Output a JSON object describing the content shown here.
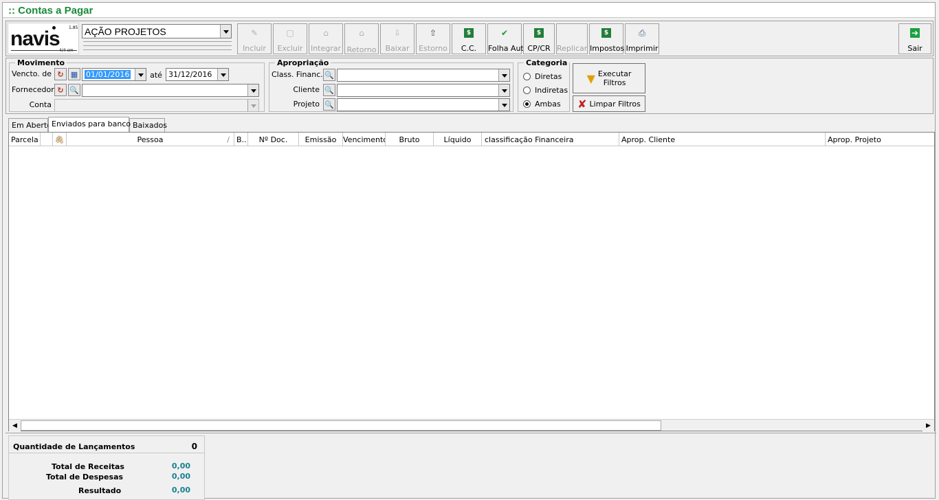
{
  "window": {
    "title": ":: Contas a Pagar"
  },
  "logo": {
    "text": "navis",
    "small_top": "1,85",
    "small_bottom": "4/4 cm"
  },
  "company": {
    "selected": "AÇÃO PROJETOS"
  },
  "toolbar": {
    "incluir": "Incluir",
    "excluir": "Excluir",
    "integrar": "Integrar",
    "retorno": "Retorno",
    "baixar": "Baixar",
    "estorno": "Estorno",
    "cc": "C.C.",
    "folha_aut": "Folha Aut.",
    "cpcr": "CP/CR",
    "replicar": "Replicar",
    "impostos": "Impostos",
    "imprimir": "Imprimir",
    "sair": "Sair"
  },
  "icons": {
    "dollar": "$",
    "check": "✔",
    "exit": "➔",
    "search": "🔍",
    "refresh": "↻",
    "calendar": "▦",
    "funnel": "▼",
    "clear": "✘"
  },
  "movimento": {
    "title": "Movimento",
    "vencto_label": "Vencto. de",
    "date_from": "01/01/2016",
    "ate_label": "até",
    "date_to": "31/12/2016",
    "fornecedor_label": "Fornecedor",
    "fornecedor_value": "",
    "conta_label": "Conta",
    "conta_value": ""
  },
  "apropriacao": {
    "title": "Apropriação",
    "class_label": "Class. Financ.",
    "cliente_label": "Cliente",
    "projeto_label": "Projeto"
  },
  "categoria": {
    "title": "Categoria",
    "options": [
      "Diretas",
      "Indiretas",
      "Ambas"
    ],
    "selected": "Ambas"
  },
  "actions": {
    "executar": "Executar Filtros",
    "executar_l1": "Executar",
    "executar_l2": "Filtros",
    "limpar": "Limpar Filtros"
  },
  "tabs": [
    {
      "label": "Em Aberto"
    },
    {
      "label": "Enviados para banco",
      "active": true
    },
    {
      "label": "Baixados"
    }
  ],
  "grid": {
    "columns": [
      "Parcela",
      "",
      "Pessoa",
      "B..",
      "Nº Doc.",
      "Emissão",
      "Vencimento",
      "Bruto",
      "Líquido",
      "classificação Financeira",
      "Aprop. Cliente",
      "Aprop. Projeto"
    ],
    "sort_indicator": "/",
    "rows": []
  },
  "summary": {
    "qtd_label": "Quantidade de Lançamentos",
    "qtd_value": "0",
    "receitas_label": "Total de Receitas",
    "receitas_value": "0,00",
    "despesas_label": "Total de Despesas",
    "despesas_value": "0,00",
    "resultado_label": "Resultado",
    "resultado_value": "0,00"
  }
}
